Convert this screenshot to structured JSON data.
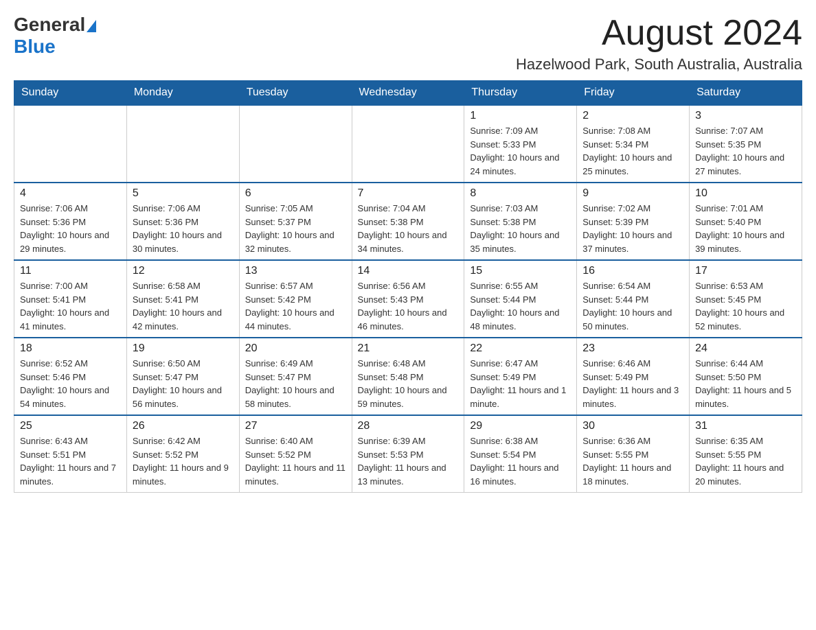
{
  "header": {
    "month_title": "August 2024",
    "location": "Hazelwood Park, South Australia, Australia",
    "logo_general": "General",
    "logo_blue": "Blue"
  },
  "days_of_week": [
    "Sunday",
    "Monday",
    "Tuesday",
    "Wednesday",
    "Thursday",
    "Friday",
    "Saturday"
  ],
  "weeks": [
    {
      "days": [
        {
          "number": "",
          "info": ""
        },
        {
          "number": "",
          "info": ""
        },
        {
          "number": "",
          "info": ""
        },
        {
          "number": "",
          "info": ""
        },
        {
          "number": "1",
          "info": "Sunrise: 7:09 AM\nSunset: 5:33 PM\nDaylight: 10 hours and 24 minutes."
        },
        {
          "number": "2",
          "info": "Sunrise: 7:08 AM\nSunset: 5:34 PM\nDaylight: 10 hours and 25 minutes."
        },
        {
          "number": "3",
          "info": "Sunrise: 7:07 AM\nSunset: 5:35 PM\nDaylight: 10 hours and 27 minutes."
        }
      ]
    },
    {
      "days": [
        {
          "number": "4",
          "info": "Sunrise: 7:06 AM\nSunset: 5:36 PM\nDaylight: 10 hours and 29 minutes."
        },
        {
          "number": "5",
          "info": "Sunrise: 7:06 AM\nSunset: 5:36 PM\nDaylight: 10 hours and 30 minutes."
        },
        {
          "number": "6",
          "info": "Sunrise: 7:05 AM\nSunset: 5:37 PM\nDaylight: 10 hours and 32 minutes."
        },
        {
          "number": "7",
          "info": "Sunrise: 7:04 AM\nSunset: 5:38 PM\nDaylight: 10 hours and 34 minutes."
        },
        {
          "number": "8",
          "info": "Sunrise: 7:03 AM\nSunset: 5:38 PM\nDaylight: 10 hours and 35 minutes."
        },
        {
          "number": "9",
          "info": "Sunrise: 7:02 AM\nSunset: 5:39 PM\nDaylight: 10 hours and 37 minutes."
        },
        {
          "number": "10",
          "info": "Sunrise: 7:01 AM\nSunset: 5:40 PM\nDaylight: 10 hours and 39 minutes."
        }
      ]
    },
    {
      "days": [
        {
          "number": "11",
          "info": "Sunrise: 7:00 AM\nSunset: 5:41 PM\nDaylight: 10 hours and 41 minutes."
        },
        {
          "number": "12",
          "info": "Sunrise: 6:58 AM\nSunset: 5:41 PM\nDaylight: 10 hours and 42 minutes."
        },
        {
          "number": "13",
          "info": "Sunrise: 6:57 AM\nSunset: 5:42 PM\nDaylight: 10 hours and 44 minutes."
        },
        {
          "number": "14",
          "info": "Sunrise: 6:56 AM\nSunset: 5:43 PM\nDaylight: 10 hours and 46 minutes."
        },
        {
          "number": "15",
          "info": "Sunrise: 6:55 AM\nSunset: 5:44 PM\nDaylight: 10 hours and 48 minutes."
        },
        {
          "number": "16",
          "info": "Sunrise: 6:54 AM\nSunset: 5:44 PM\nDaylight: 10 hours and 50 minutes."
        },
        {
          "number": "17",
          "info": "Sunrise: 6:53 AM\nSunset: 5:45 PM\nDaylight: 10 hours and 52 minutes."
        }
      ]
    },
    {
      "days": [
        {
          "number": "18",
          "info": "Sunrise: 6:52 AM\nSunset: 5:46 PM\nDaylight: 10 hours and 54 minutes."
        },
        {
          "number": "19",
          "info": "Sunrise: 6:50 AM\nSunset: 5:47 PM\nDaylight: 10 hours and 56 minutes."
        },
        {
          "number": "20",
          "info": "Sunrise: 6:49 AM\nSunset: 5:47 PM\nDaylight: 10 hours and 58 minutes."
        },
        {
          "number": "21",
          "info": "Sunrise: 6:48 AM\nSunset: 5:48 PM\nDaylight: 10 hours and 59 minutes."
        },
        {
          "number": "22",
          "info": "Sunrise: 6:47 AM\nSunset: 5:49 PM\nDaylight: 11 hours and 1 minute."
        },
        {
          "number": "23",
          "info": "Sunrise: 6:46 AM\nSunset: 5:49 PM\nDaylight: 11 hours and 3 minutes."
        },
        {
          "number": "24",
          "info": "Sunrise: 6:44 AM\nSunset: 5:50 PM\nDaylight: 11 hours and 5 minutes."
        }
      ]
    },
    {
      "days": [
        {
          "number": "25",
          "info": "Sunrise: 6:43 AM\nSunset: 5:51 PM\nDaylight: 11 hours and 7 minutes."
        },
        {
          "number": "26",
          "info": "Sunrise: 6:42 AM\nSunset: 5:52 PM\nDaylight: 11 hours and 9 minutes."
        },
        {
          "number": "27",
          "info": "Sunrise: 6:40 AM\nSunset: 5:52 PM\nDaylight: 11 hours and 11 minutes."
        },
        {
          "number": "28",
          "info": "Sunrise: 6:39 AM\nSunset: 5:53 PM\nDaylight: 11 hours and 13 minutes."
        },
        {
          "number": "29",
          "info": "Sunrise: 6:38 AM\nSunset: 5:54 PM\nDaylight: 11 hours and 16 minutes."
        },
        {
          "number": "30",
          "info": "Sunrise: 6:36 AM\nSunset: 5:55 PM\nDaylight: 11 hours and 18 minutes."
        },
        {
          "number": "31",
          "info": "Sunrise: 6:35 AM\nSunset: 5:55 PM\nDaylight: 11 hours and 20 minutes."
        }
      ]
    }
  ]
}
